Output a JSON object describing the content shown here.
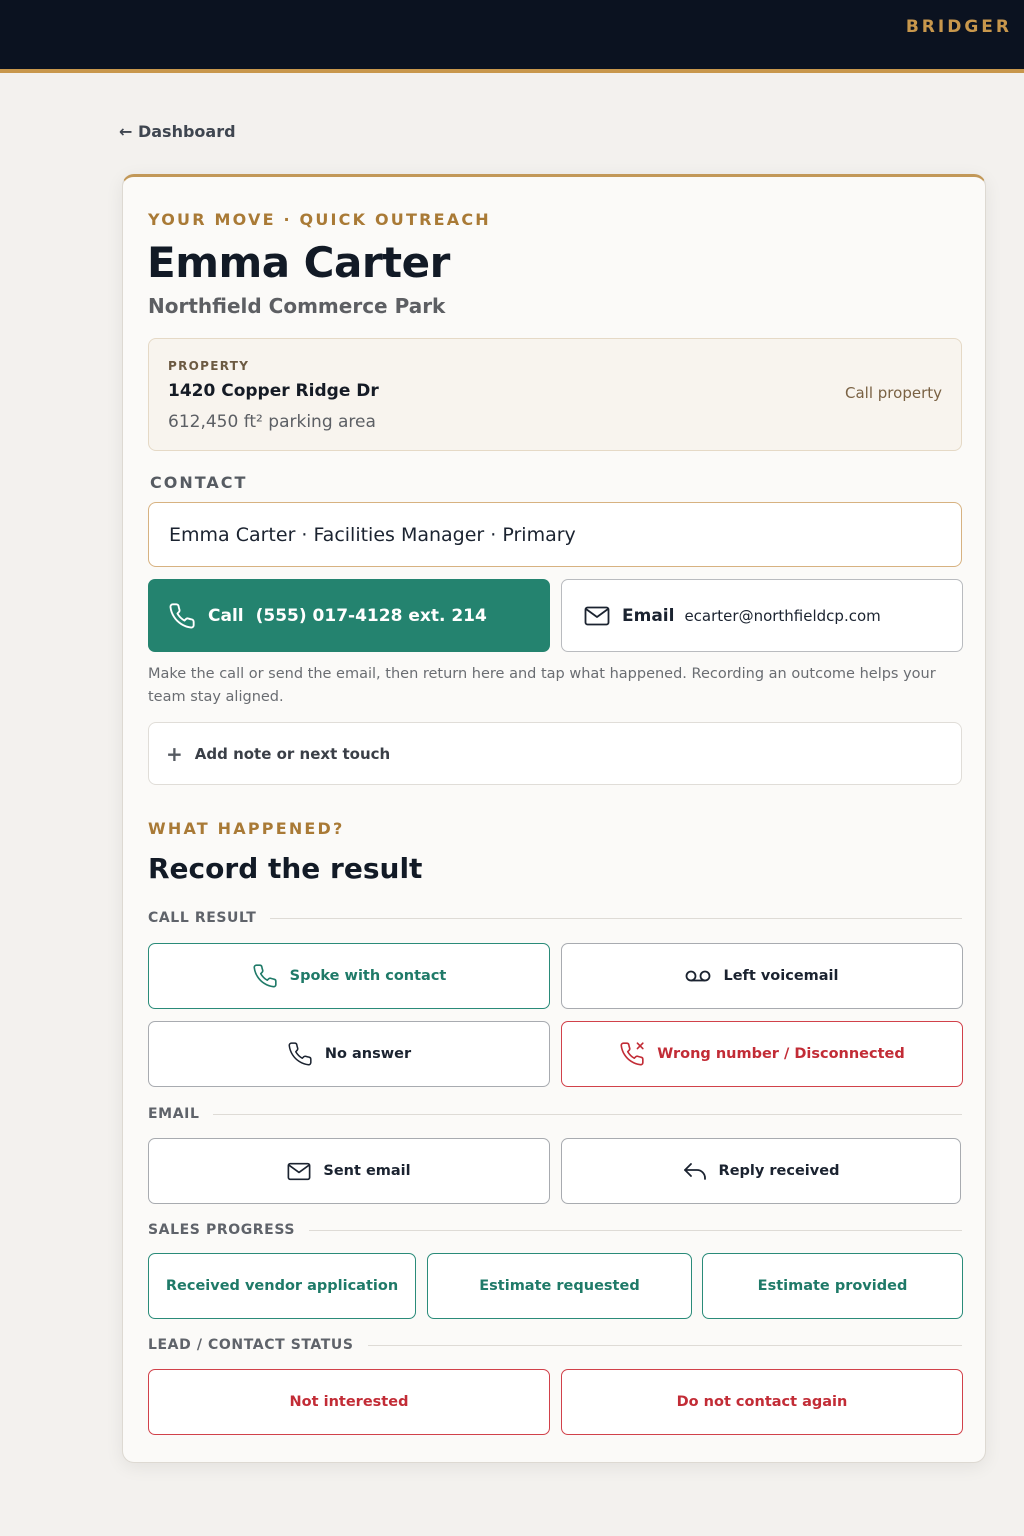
{
  "app": {
    "brand": "BRIDGER"
  },
  "nav": {
    "back_label": "← Dashboard"
  },
  "header": {
    "eyebrow": "YOUR MOVE · QUICK OUTREACH",
    "name": "Emma Carter",
    "company": "Northfield Commerce Park"
  },
  "property": {
    "label": "PROPERTY",
    "address": "1420 Copper Ridge Dr",
    "area": "612,450 ft² parking area",
    "call_label": "Call property"
  },
  "contact": {
    "section_label": "CONTACT",
    "selected": "Emma Carter · Facilities Manager · Primary"
  },
  "actions": {
    "call_label": "Call",
    "call_number": "(555) 017-4128 ext. 214",
    "email_label": "Email",
    "email_address": "ecarter@northfieldcp.com",
    "helper": "Make the call or send the email, then return here and tap what happened. Recording an outcome helps your team stay aligned.",
    "add_note": "Add note or next touch"
  },
  "result": {
    "eyebrow": "WHAT HAPPENED?",
    "title": "Record the result",
    "call_group": "CALL RESULT",
    "call_options": {
      "spoke": "Spoke with contact",
      "voicemail": "Left voicemail",
      "no_answer": "No answer",
      "wrong_number": "Wrong number / Disconnected"
    },
    "email_group": "EMAIL",
    "email_options": {
      "sent": "Sent email",
      "reply": "Reply received"
    },
    "sales_group": "SALES PROGRESS",
    "sales_options": {
      "vendor_app": "Received vendor application",
      "estimate_requested": "Estimate requested",
      "estimate_provided": "Estimate provided"
    },
    "status_group": "LEAD / CONTACT STATUS",
    "status_options": {
      "not_interested": "Not interested",
      "do_not_contact": "Do not contact again"
    }
  },
  "colors": {
    "accent_gold": "#c8974c",
    "primary_green": "#24836f",
    "danger_red": "#c22c36",
    "navy": "#0b1220"
  }
}
